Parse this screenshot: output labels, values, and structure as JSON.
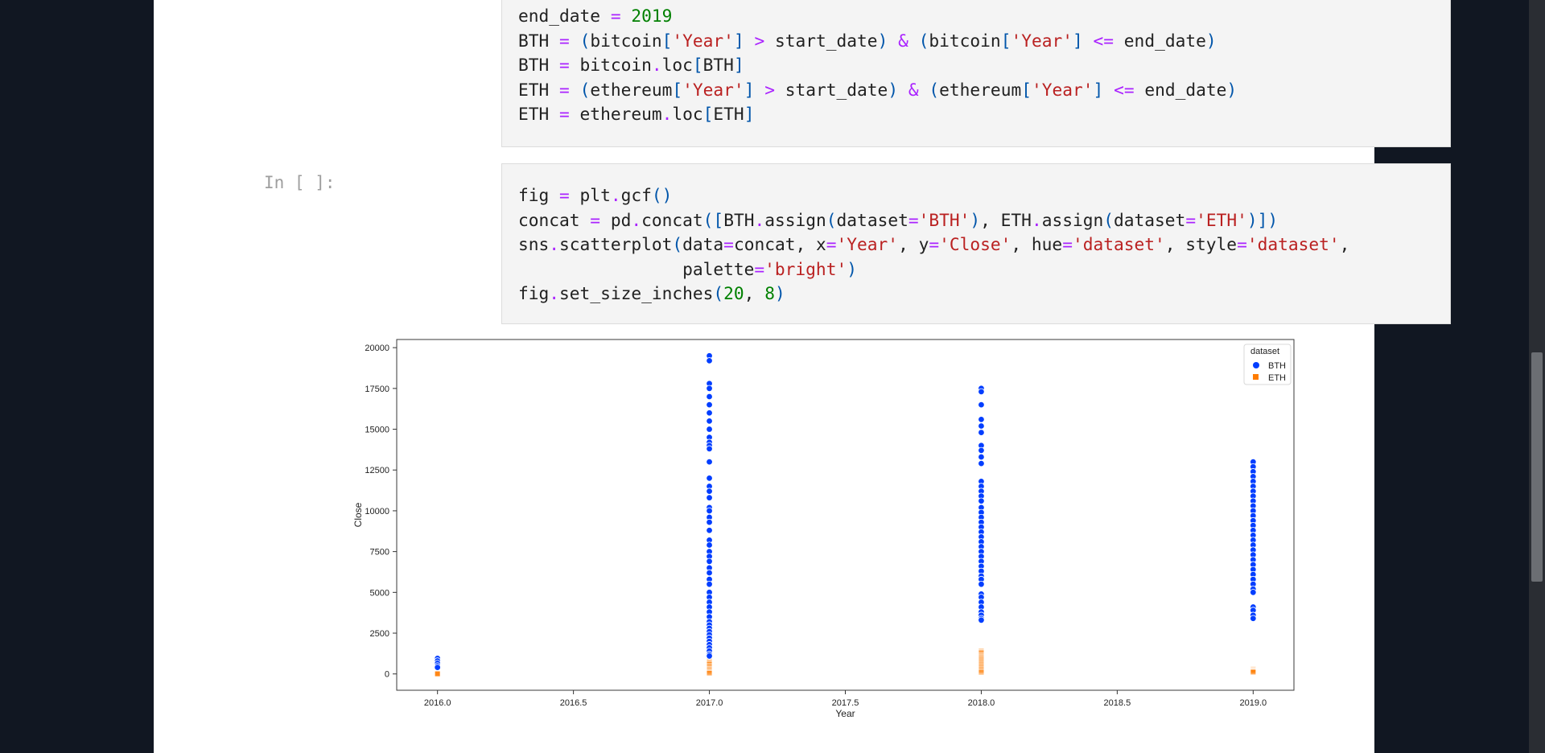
{
  "notebook": {
    "cell1": {
      "lines": [
        "end_date = 2019",
        "BTH = (bitcoin['Year'] > start_date) & (bitcoin['Year'] <= end_date)",
        "BTH = bitcoin.loc[BTH]",
        "ETH = (ethereum['Year'] > start_date) & (ethereum['Year'] <= end_date)",
        "ETH = ethereum.loc[ETH]"
      ]
    },
    "cell2": {
      "prompt": "In [ ]:",
      "lines": [
        "fig = plt.gcf()",
        "concat = pd.concat([BTH.assign(dataset='BTH'), ETH.assign(dataset='ETH')])",
        "sns.scatterplot(data=concat, x='Year', y='Close', hue='dataset', style='dataset',",
        "                palette='bright')",
        "fig.set_size_inches(20, 8)"
      ]
    }
  },
  "chart_data": {
    "type": "scatter",
    "xlabel": "Year",
    "ylabel": "Close",
    "xlim": [
      2015.85,
      2019.15
    ],
    "ylim": [
      -1000,
      20500
    ],
    "xticks": [
      2016.0,
      2016.5,
      2017.0,
      2017.5,
      2018.0,
      2018.5,
      2019.0
    ],
    "xtick_labels": [
      "2016.0",
      "2016.5",
      "2017.0",
      "2017.5",
      "2018.0",
      "2018.5",
      "2019.0"
    ],
    "yticks": [
      0,
      2500,
      5000,
      7500,
      10000,
      12500,
      15000,
      17500,
      20000
    ],
    "ytick_labels": [
      "0",
      "2500",
      "5000",
      "7500",
      "10000",
      "12500",
      "15000",
      "17500",
      "20000"
    ],
    "grid": false,
    "legend": {
      "title": "dataset",
      "position": "top-right"
    },
    "series": [
      {
        "name": "BTH",
        "color": "#023eff",
        "marker": "circle",
        "points": [
          [
            2016,
            950
          ],
          [
            2016,
            800
          ],
          [
            2016,
            650
          ],
          [
            2016,
            500
          ],
          [
            2016,
            400
          ],
          [
            2017,
            19500
          ],
          [
            2017,
            19200
          ],
          [
            2017,
            17800
          ],
          [
            2017,
            17500
          ],
          [
            2017,
            17000
          ],
          [
            2017,
            16500
          ],
          [
            2017,
            16000
          ],
          [
            2017,
            15500
          ],
          [
            2017,
            15000
          ],
          [
            2017,
            14500
          ],
          [
            2017,
            14200
          ],
          [
            2017,
            14000
          ],
          [
            2017,
            13800
          ],
          [
            2017,
            13000
          ],
          [
            2017,
            12000
          ],
          [
            2017,
            11500
          ],
          [
            2017,
            11200
          ],
          [
            2017,
            10800
          ],
          [
            2017,
            10200
          ],
          [
            2017,
            10000
          ],
          [
            2017,
            9600
          ],
          [
            2017,
            9300
          ],
          [
            2017,
            8800
          ],
          [
            2017,
            8200
          ],
          [
            2017,
            7900
          ],
          [
            2017,
            7500
          ],
          [
            2017,
            7200
          ],
          [
            2017,
            6900
          ],
          [
            2017,
            6500
          ],
          [
            2017,
            6200
          ],
          [
            2017,
            5800
          ],
          [
            2017,
            5500
          ],
          [
            2017,
            5000
          ],
          [
            2017,
            4700
          ],
          [
            2017,
            4400
          ],
          [
            2017,
            4100
          ],
          [
            2017,
            3800
          ],
          [
            2017,
            3500
          ],
          [
            2017,
            3200
          ],
          [
            2017,
            3000
          ],
          [
            2017,
            2800
          ],
          [
            2017,
            2600
          ],
          [
            2017,
            2400
          ],
          [
            2017,
            2200
          ],
          [
            2017,
            2000
          ],
          [
            2017,
            1800
          ],
          [
            2017,
            1600
          ],
          [
            2017,
            1400
          ],
          [
            2017,
            1200
          ],
          [
            2017,
            1100
          ],
          [
            2018,
            17500
          ],
          [
            2018,
            17300
          ],
          [
            2018,
            16500
          ],
          [
            2018,
            15600
          ],
          [
            2018,
            15200
          ],
          [
            2018,
            14800
          ],
          [
            2018,
            14000
          ],
          [
            2018,
            13700
          ],
          [
            2018,
            13300
          ],
          [
            2018,
            12900
          ],
          [
            2018,
            11800
          ],
          [
            2018,
            11500
          ],
          [
            2018,
            11200
          ],
          [
            2018,
            10900
          ],
          [
            2018,
            10600
          ],
          [
            2018,
            10200
          ],
          [
            2018,
            9900
          ],
          [
            2018,
            9600
          ],
          [
            2018,
            9300
          ],
          [
            2018,
            9000
          ],
          [
            2018,
            8700
          ],
          [
            2018,
            8400
          ],
          [
            2018,
            8100
          ],
          [
            2018,
            7800
          ],
          [
            2018,
            7500
          ],
          [
            2018,
            7200
          ],
          [
            2018,
            6900
          ],
          [
            2018,
            6600
          ],
          [
            2018,
            6300
          ],
          [
            2018,
            6000
          ],
          [
            2018,
            5800
          ],
          [
            2018,
            5500
          ],
          [
            2018,
            4900
          ],
          [
            2018,
            4700
          ],
          [
            2018,
            4400
          ],
          [
            2018,
            4100
          ],
          [
            2018,
            3800
          ],
          [
            2018,
            3600
          ],
          [
            2018,
            3400
          ],
          [
            2018,
            3300
          ],
          [
            2019,
            13000
          ],
          [
            2019,
            12700
          ],
          [
            2019,
            12400
          ],
          [
            2019,
            12100
          ],
          [
            2019,
            11800
          ],
          [
            2019,
            11500
          ],
          [
            2019,
            11200
          ],
          [
            2019,
            10900
          ],
          [
            2019,
            10600
          ],
          [
            2019,
            10300
          ],
          [
            2019,
            10000
          ],
          [
            2019,
            9700
          ],
          [
            2019,
            9400
          ],
          [
            2019,
            9100
          ],
          [
            2019,
            8800
          ],
          [
            2019,
            8500
          ],
          [
            2019,
            8200
          ],
          [
            2019,
            7900
          ],
          [
            2019,
            7600
          ],
          [
            2019,
            7300
          ],
          [
            2019,
            7000
          ],
          [
            2019,
            6700
          ],
          [
            2019,
            6400
          ],
          [
            2019,
            6100
          ],
          [
            2019,
            5800
          ],
          [
            2019,
            5500
          ],
          [
            2019,
            5200
          ],
          [
            2019,
            5000
          ],
          [
            2019,
            4100
          ],
          [
            2019,
            3900
          ],
          [
            2019,
            3600
          ],
          [
            2019,
            3400
          ]
        ]
      },
      {
        "name": "ETH",
        "color": "#ff7c00",
        "marker": "x",
        "points": [
          [
            2016,
            50
          ],
          [
            2016,
            20
          ],
          [
            2016,
            10
          ],
          [
            2016,
            5
          ],
          [
            2017,
            800
          ],
          [
            2017,
            700
          ],
          [
            2017,
            600
          ],
          [
            2017,
            450
          ],
          [
            2017,
            300
          ],
          [
            2017,
            200
          ],
          [
            2017,
            100
          ],
          [
            2017,
            50
          ],
          [
            2018,
            1400
          ],
          [
            2018,
            1300
          ],
          [
            2018,
            1100
          ],
          [
            2018,
            1000
          ],
          [
            2018,
            900
          ],
          [
            2018,
            800
          ],
          [
            2018,
            700
          ],
          [
            2018,
            600
          ],
          [
            2018,
            500
          ],
          [
            2018,
            400
          ],
          [
            2018,
            300
          ],
          [
            2018,
            200
          ],
          [
            2018,
            100
          ],
          [
            2019,
            300
          ],
          [
            2019,
            250
          ],
          [
            2019,
            200
          ],
          [
            2019,
            150
          ],
          [
            2019,
            110
          ]
        ]
      }
    ]
  }
}
